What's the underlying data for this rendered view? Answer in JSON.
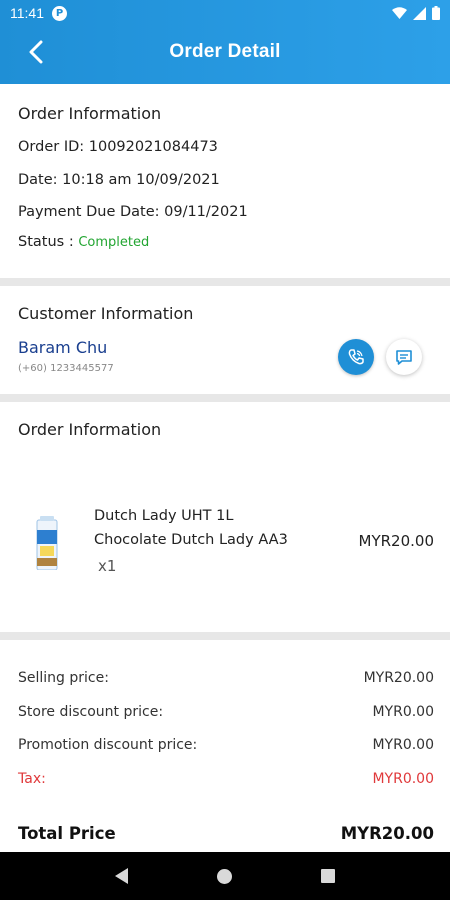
{
  "status_bar": {
    "time": "11:41",
    "badge": "P"
  },
  "header": {
    "title": "Order Detail"
  },
  "order_info": {
    "title": "Order Information",
    "order_id": "Order ID: 10092021084473",
    "date": "Date: 10:18 am 10/09/2021",
    "payment_due": "Payment Due Date: 09/11/2021",
    "status_label": "Status : ",
    "status_value": "Completed"
  },
  "customer_info": {
    "title": "Customer Information",
    "name": "Baram Chu",
    "phone": "(+60) 1233445577"
  },
  "order_items": {
    "title": "Order Information",
    "items": [
      {
        "name_line1": "Dutch Lady UHT 1L",
        "name_line2": "Chocolate Dutch Lady AA3",
        "qty": "x1",
        "price": "MYR20.00"
      }
    ]
  },
  "summary": {
    "selling_label": "Selling price:",
    "selling_value": "MYR20.00",
    "store_discount_label": "Store discount price:",
    "store_discount_value": "MYR0.00",
    "promo_discount_label": "Promotion discount price:",
    "promo_discount_value": "MYR0.00",
    "tax_label": "Tax:",
    "tax_value": "MYR0.00",
    "total_label": "Total Price",
    "total_value": "MYR20.00"
  },
  "colors": {
    "accent": "#1f8fd6",
    "status_completed": "#22a531",
    "tax": "#e0393b",
    "customer_name": "#1a3f8f"
  },
  "icons": {
    "back": "arrow-left-icon",
    "call": "phone-icon",
    "chat": "chat-icon"
  }
}
